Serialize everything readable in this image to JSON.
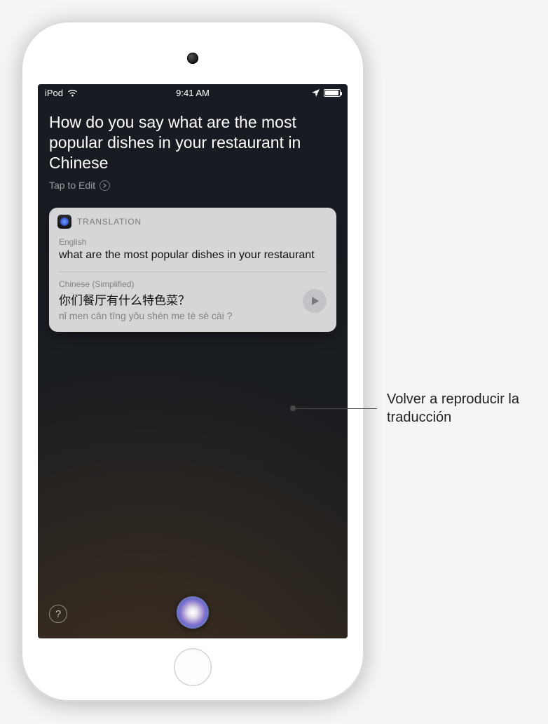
{
  "statusbar": {
    "carrier": "iPod",
    "time": "9:41 AM"
  },
  "query": {
    "text": "How do you say what are the most popular dishes in your restaurant in Chinese",
    "tap_to_edit": "Tap to Edit"
  },
  "card": {
    "title": "TRANSLATION",
    "source_lang": "English",
    "source_text": "what are the most popular dishes in your restaurant",
    "target_lang": "Chinese (Simplified)",
    "target_text": "你们餐厅有什么特色菜？",
    "romanization": "nǐ men cān tīng yǒu shén me tè sè cài ?"
  },
  "bottom": {
    "help": "?"
  },
  "callout": {
    "text": "Volver a reproducir la traducción"
  },
  "colors": {
    "card_bg": "rgba(255,255,255,0.82)",
    "muted": "rgba(60,60,67,0.55)"
  }
}
